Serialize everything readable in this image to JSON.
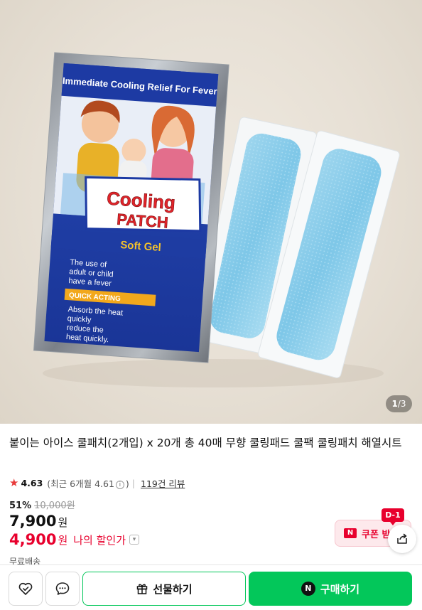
{
  "hero": {
    "counter_current": "1",
    "counter_total": "/3",
    "package": {
      "banner": "Immediate Cooling Relief For Fever",
      "logo_line1": "Cooling",
      "logo_line2": "PATCH",
      "subtitle": "Soft Gel",
      "use_text_1": "The use of",
      "use_text_2": "adult or child",
      "use_text_3": "have a fever",
      "quick_acting": "QUICK ACTING",
      "absorb_1": "Absorb the heat",
      "absorb_2": "quickly",
      "absorb_3": "reduce the",
      "absorb_4": "heat quickly."
    }
  },
  "product": {
    "title": "붙이는 아이스 쿨패치(2개입) x 20개 총 40매 무향 쿨링패드 쿨팩 쿨링패치 해열시트",
    "rating": "4.63",
    "recent_prefix": "(최근 6개월 4.61",
    "recent_suffix": ")",
    "info_icon": "i",
    "reviews": "119건 리뷰",
    "discount_rate": "51%",
    "original_price": "10,000원",
    "price": "7,900",
    "price_unit": "원",
    "my_price": "4,900",
    "my_price_unit": "원",
    "my_price_label": "나의 할인가",
    "shipping": "무료배송"
  },
  "coupon": {
    "dday": "D-1",
    "label": "쿠폰 받",
    "badge": "N"
  },
  "bottom_bar": {
    "gift_label": "선물하기",
    "buy_label": "구매하기",
    "buy_badge": "N"
  },
  "colors": {
    "naver_green": "#03c75a",
    "sale_red": "#e8002d",
    "star_red": "#e83b3b"
  },
  "icons": {
    "wishlist": "heart-check-icon",
    "chat": "chat-bubble-icon",
    "share": "share-icon",
    "gift": "gift-icon",
    "star": "star-icon"
  }
}
